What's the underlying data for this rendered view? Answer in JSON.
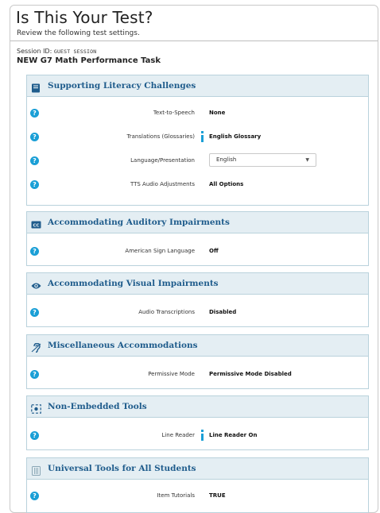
{
  "header": {
    "title": "Is This Your Test?",
    "subtitle": "Review the following test settings.",
    "session_label": "Session ID:",
    "session_id": "GUEST SESSION",
    "test_name": "NEW G7 Math Performance Task"
  },
  "sections": [
    {
      "title": "Supporting Literacy Challenges",
      "icon": "book-icon",
      "rows": [
        {
          "label": "Text-to-Speech",
          "value": "None"
        },
        {
          "label": "Translations (Glossaries)",
          "value": "English Glossary"
        },
        {
          "label": "Language/Presentation",
          "value": "English"
        },
        {
          "label": "TTS Audio Adjustments",
          "value": "All Options"
        }
      ]
    },
    {
      "title": "Accommodating Auditory Impairments",
      "icon": "closed-caption-icon",
      "rows": [
        {
          "label": "American Sign Language",
          "value": "Off"
        }
      ]
    },
    {
      "title": "Accommodating Visual Impairments",
      "icon": "eye-icon",
      "rows": [
        {
          "label": "Audio Transcriptions",
          "value": "Disabled"
        }
      ]
    },
    {
      "title": "Miscellaneous Accommodations",
      "icon": "ear-icon",
      "rows": [
        {
          "label": "Permissive Mode",
          "value": "Permissive Mode Disabled"
        }
      ]
    },
    {
      "title": "Non-Embedded Tools",
      "icon": "target-icon",
      "rows": [
        {
          "label": "Line Reader",
          "value": "Line Reader On"
        }
      ]
    },
    {
      "title": "Universal Tools for All Students",
      "icon": "calculator-icon",
      "rows": [
        {
          "label": "Item Tutorials",
          "value": "TRUE"
        }
      ]
    }
  ],
  "colors": {
    "section_title": "#1f5c8c",
    "section_header_bg": "#e4eef3",
    "help_icon": "#1a9fd6"
  }
}
